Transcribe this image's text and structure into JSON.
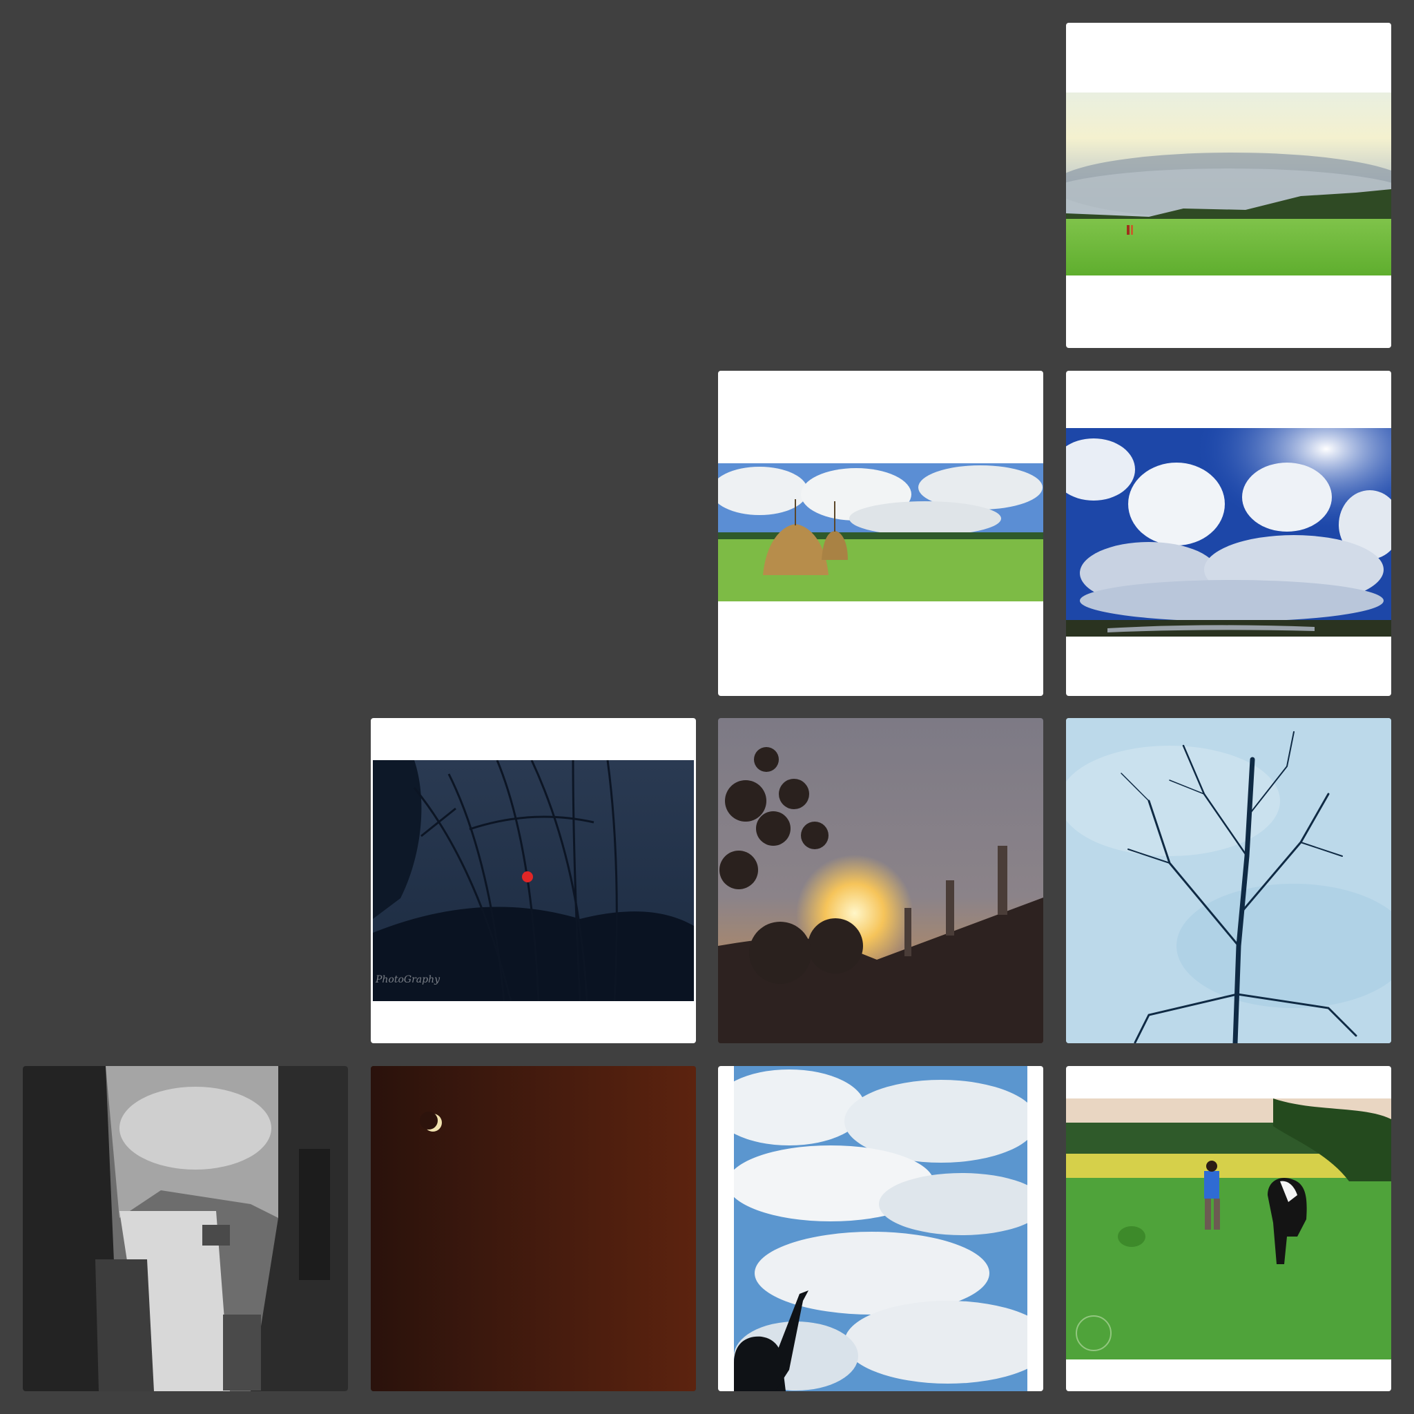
{
  "gallery": {
    "background": "#404040",
    "tiles": [
      {
        "scene": "panorama-green-field-cloudy-sky"
      },
      {
        "scene": "haystacks-in-field"
      },
      {
        "scene": "blue-sky-cumulus-clouds-river"
      },
      {
        "scene": "red-sun-through-grass-silhouette",
        "watermark": "PhotoGraphy"
      },
      {
        "scene": "sunset-behind-rooftop-pillars"
      },
      {
        "scene": "bare-tree-against-pale-blue-sky"
      },
      {
        "scene": "black-white-buildings-looking-up"
      },
      {
        "scene": "crescent-moon-dark-red-sky"
      },
      {
        "scene": "child-pointing-at-clouds"
      },
      {
        "scene": "boy-with-cow-in-field"
      }
    ]
  }
}
